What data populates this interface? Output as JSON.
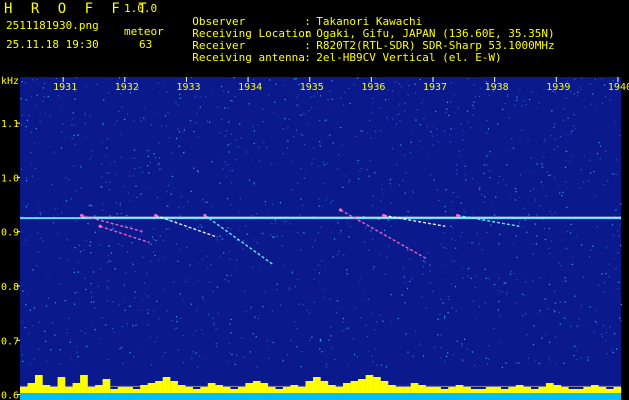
{
  "header": {
    "app_title": "H R O F F T",
    "app_version": "1.0.0",
    "file_name": "2511181930.png",
    "date_time": "25.11.18 19:30",
    "meteor_label": "meteor",
    "meteor_count": "63"
  },
  "station_info": [
    {
      "key": "Observer",
      "sep": ":",
      "value": "Takanori Kawachi"
    },
    {
      "key": "Receiving Location",
      "sep": ":",
      "value": "Ogaki, Gifu, JAPAN (136.60E, 35.35N)"
    },
    {
      "key": "Receiver",
      "sep": ":",
      "value": "R820T2(RTL-SDR) SDR-Sharp 53.1000MHz"
    },
    {
      "key": "Receiving antenna",
      "sep": ":",
      "value": "2el-HB9CV Vertical (el. E-W)"
    }
  ],
  "chart_data": {
    "type": "heatmap",
    "ylabel": "kHz",
    "y_ticks": [
      "1.1",
      "1.0",
      "0.9",
      "0.8",
      "0.7",
      "0.6"
    ],
    "x_ticks": [
      "1931",
      "1932",
      "1933",
      "1934",
      "1935",
      "1936",
      "1937",
      "1938",
      "1939",
      "1940"
    ],
    "background_color": "#0a1a8c",
    "carrier_frequency_khz": 0.925,
    "carrier_color": "#66ddff",
    "trace_colors": [
      "#ff66cc",
      "#ffffff",
      "#66ffff"
    ],
    "meteor_traces": [
      {
        "start_min": 1931.3,
        "end_min": 1932.3,
        "start_khz": 0.93,
        "end_khz": 0.9
      },
      {
        "start_min": 1932.5,
        "end_min": 1933.5,
        "start_khz": 0.93,
        "end_khz": 0.89
      },
      {
        "start_min": 1933.3,
        "end_min": 1934.4,
        "start_khz": 0.93,
        "end_khz": 0.84
      },
      {
        "start_min": 1935.5,
        "end_min": 1936.9,
        "start_khz": 0.94,
        "end_khz": 0.85
      },
      {
        "start_min": 1936.2,
        "end_min": 1937.2,
        "start_khz": 0.93,
        "end_khz": 0.91
      },
      {
        "start_min": 1937.4,
        "end_min": 1938.4,
        "start_khz": 0.93,
        "end_khz": 0.91
      },
      {
        "start_min": 1931.6,
        "end_min": 1932.4,
        "start_khz": 0.91,
        "end_khz": 0.88
      }
    ],
    "meteor_activity": [
      0.3,
      0.5,
      0.9,
      0.4,
      0.3,
      0.8,
      0.3,
      0.5,
      0.9,
      0.3,
      0.4,
      0.7,
      0.2,
      0.3,
      0.3,
      0.2,
      0.4,
      0.5,
      0.6,
      0.8,
      0.6,
      0.4,
      0.3,
      0.2,
      0.3,
      0.5,
      0.4,
      0.3,
      0.2,
      0.3,
      0.5,
      0.6,
      0.5,
      0.3,
      0.2,
      0.3,
      0.4,
      0.3,
      0.6,
      0.8,
      0.6,
      0.4,
      0.3,
      0.5,
      0.6,
      0.7,
      0.9,
      0.8,
      0.6,
      0.4,
      0.3,
      0.3,
      0.5,
      0.4,
      0.3,
      0.3,
      0.2,
      0.3,
      0.4,
      0.3,
      0.2,
      0.2,
      0.3,
      0.3,
      0.2,
      0.3,
      0.4,
      0.3,
      0.2,
      0.3,
      0.5,
      0.4,
      0.3,
      0.2,
      0.2,
      0.3,
      0.4,
      0.3,
      0.2,
      0.3
    ],
    "activity_color": "#ffff00",
    "activity_base_color": "#00bfff"
  }
}
